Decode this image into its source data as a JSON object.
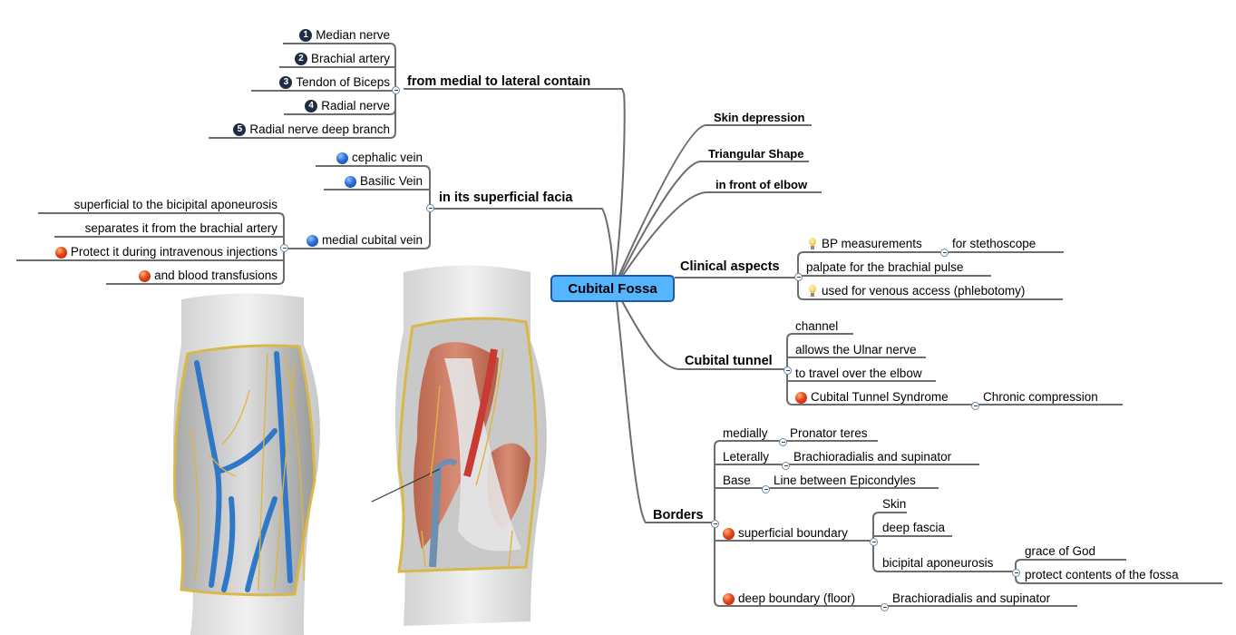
{
  "root": {
    "label": "Cubital Fossa",
    "color": "#55b6ff"
  },
  "left": {
    "contents": {
      "label": "from medial to lateral contain",
      "items": [
        {
          "num": "1",
          "label": "Median nerve"
        },
        {
          "num": "2",
          "label": "Brachial artery"
        },
        {
          "num": "3",
          "label": "Tendon of Biceps"
        },
        {
          "num": "4",
          "label": "Radial nerve"
        },
        {
          "num": "5",
          "label": "Radial nerve deep branch"
        }
      ]
    },
    "superficial": {
      "label": "in its superficial facia",
      "items": [
        {
          "icon": "blue-dot",
          "label": "cephalic vein"
        },
        {
          "icon": "blue-dot",
          "label": "Basilic Vein"
        },
        {
          "icon": "blue-dot",
          "label": "medial cubital vein"
        }
      ],
      "medial_cubital_children": [
        {
          "icon": "",
          "label": "superficial to the bicipital aponeurosis"
        },
        {
          "icon": "",
          "label": "separates it from the brachial artery"
        },
        {
          "icon": "red-dot",
          "label": "Protect it during intravenous injections"
        },
        {
          "icon": "red-dot",
          "label": "and blood transfusions"
        }
      ]
    }
  },
  "right": {
    "simple": [
      "Skin depression",
      "Triangular Shape",
      "in front of elbow"
    ],
    "clinical": {
      "label": "Clinical aspects",
      "items": [
        {
          "icon": "bulb",
          "label": "BP measurements",
          "child": "for stethoscope"
        },
        {
          "icon": "",
          "label": "palpate for the brachial pulse"
        },
        {
          "icon": "bulb",
          "label": "used for venous access (phlebotomy)"
        }
      ]
    },
    "tunnel": {
      "label": "Cubital tunnel",
      "items": [
        {
          "icon": "",
          "label": "channel"
        },
        {
          "icon": "",
          "label": "allows the Ulnar nerve"
        },
        {
          "icon": "",
          "label": "to travel over the elbow"
        },
        {
          "icon": "red-dot",
          "label": "Cubital Tunnel Syndrome",
          "child": "Chronic compression"
        }
      ]
    },
    "borders": {
      "label": "Borders",
      "items": [
        {
          "label": "medially",
          "child": "Pronator teres"
        },
        {
          "label": "Leterally",
          "child": "Brachioradialis and supinator"
        },
        {
          "label": "Base",
          "child": "Line between Epicondyles"
        },
        {
          "icon": "red-dot",
          "label": "superficial boundary",
          "children": [
            "Skin",
            "deep fascia",
            "bicipital aponeurosis"
          ],
          "aponeurosis_children": [
            "grace of God",
            "protect contents of the fossa"
          ]
        },
        {
          "icon": "red-dot",
          "label": "deep boundary (floor)",
          "child": "Brachioradialis and supinator"
        }
      ]
    }
  },
  "illustrations": [
    {
      "name": "superficial-veins-illustration"
    },
    {
      "name": "deep-dissection-illustration"
    }
  ]
}
